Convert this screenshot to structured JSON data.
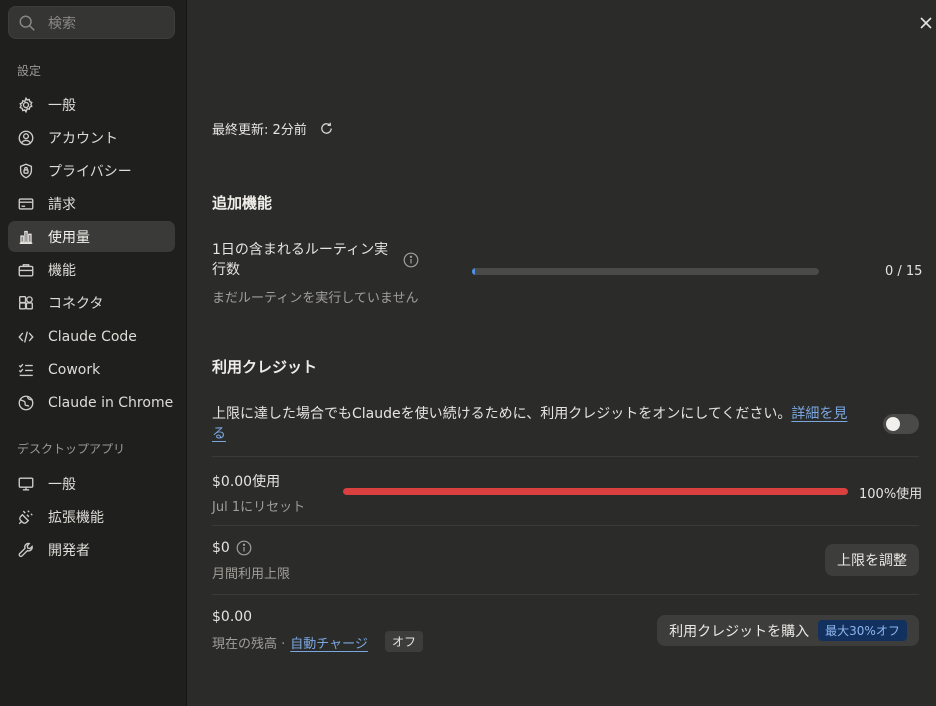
{
  "sidebar": {
    "search_placeholder": "検索",
    "section_settings": "設定",
    "items": [
      {
        "label": "一般",
        "icon": "gear-icon"
      },
      {
        "label": "アカウント",
        "icon": "user-circle-icon"
      },
      {
        "label": "プライバシー",
        "icon": "shield-icon"
      },
      {
        "label": "請求",
        "icon": "credit-card-icon"
      },
      {
        "label": "使用量",
        "icon": "bar-chart-icon",
        "active": true
      },
      {
        "label": "機能",
        "icon": "toolbox-icon"
      },
      {
        "label": "コネクタ",
        "icon": "connector-icon"
      },
      {
        "label": "Claude Code",
        "icon": "code-icon"
      },
      {
        "label": "Cowork",
        "icon": "checklist-icon"
      },
      {
        "label": "Claude in Chrome",
        "icon": "globe-icon"
      }
    ],
    "section_desktop": "デスクトップアプリ",
    "desktop_items": [
      {
        "label": "一般",
        "icon": "monitor-icon"
      },
      {
        "label": "拡張機能",
        "icon": "plug-icon"
      },
      {
        "label": "開発者",
        "icon": "wrench-icon"
      }
    ]
  },
  "main": {
    "last_updated": "最終更新: 2分前",
    "extra_features": {
      "heading": "追加機能",
      "routine_label": "1日の含まれるルーティン実行数",
      "routine_sub": "まだルーティンを実行していません",
      "routine_value": "0 / 15",
      "routine_progress": 0.01
    },
    "credits": {
      "heading": "利用クレジット",
      "description": "上限に達した場合でもClaudeを使い続けるために、利用クレジットをオンにしてください。",
      "details_link": "詳細を見る",
      "toggle_on": false,
      "usage_label": "$0.00使用",
      "reset_label": "Jul 1にリセット",
      "usage_percent_label": "100%使用",
      "usage_progress": 1.0,
      "limit_value": "$0",
      "limit_label": "月間利用上限",
      "adjust_button": "上限を調整",
      "balance_value": "$0.00",
      "balance_label": "現在の残高 ·",
      "auto_charge_link": "自動チャージ",
      "auto_charge_state": "オフ",
      "buy_button": "利用クレジットを購入",
      "buy_promo": "最大30%オフ"
    },
    "colors": {
      "accent_blue": "#4f8fe6",
      "usage_red": "#d9403f"
    }
  }
}
